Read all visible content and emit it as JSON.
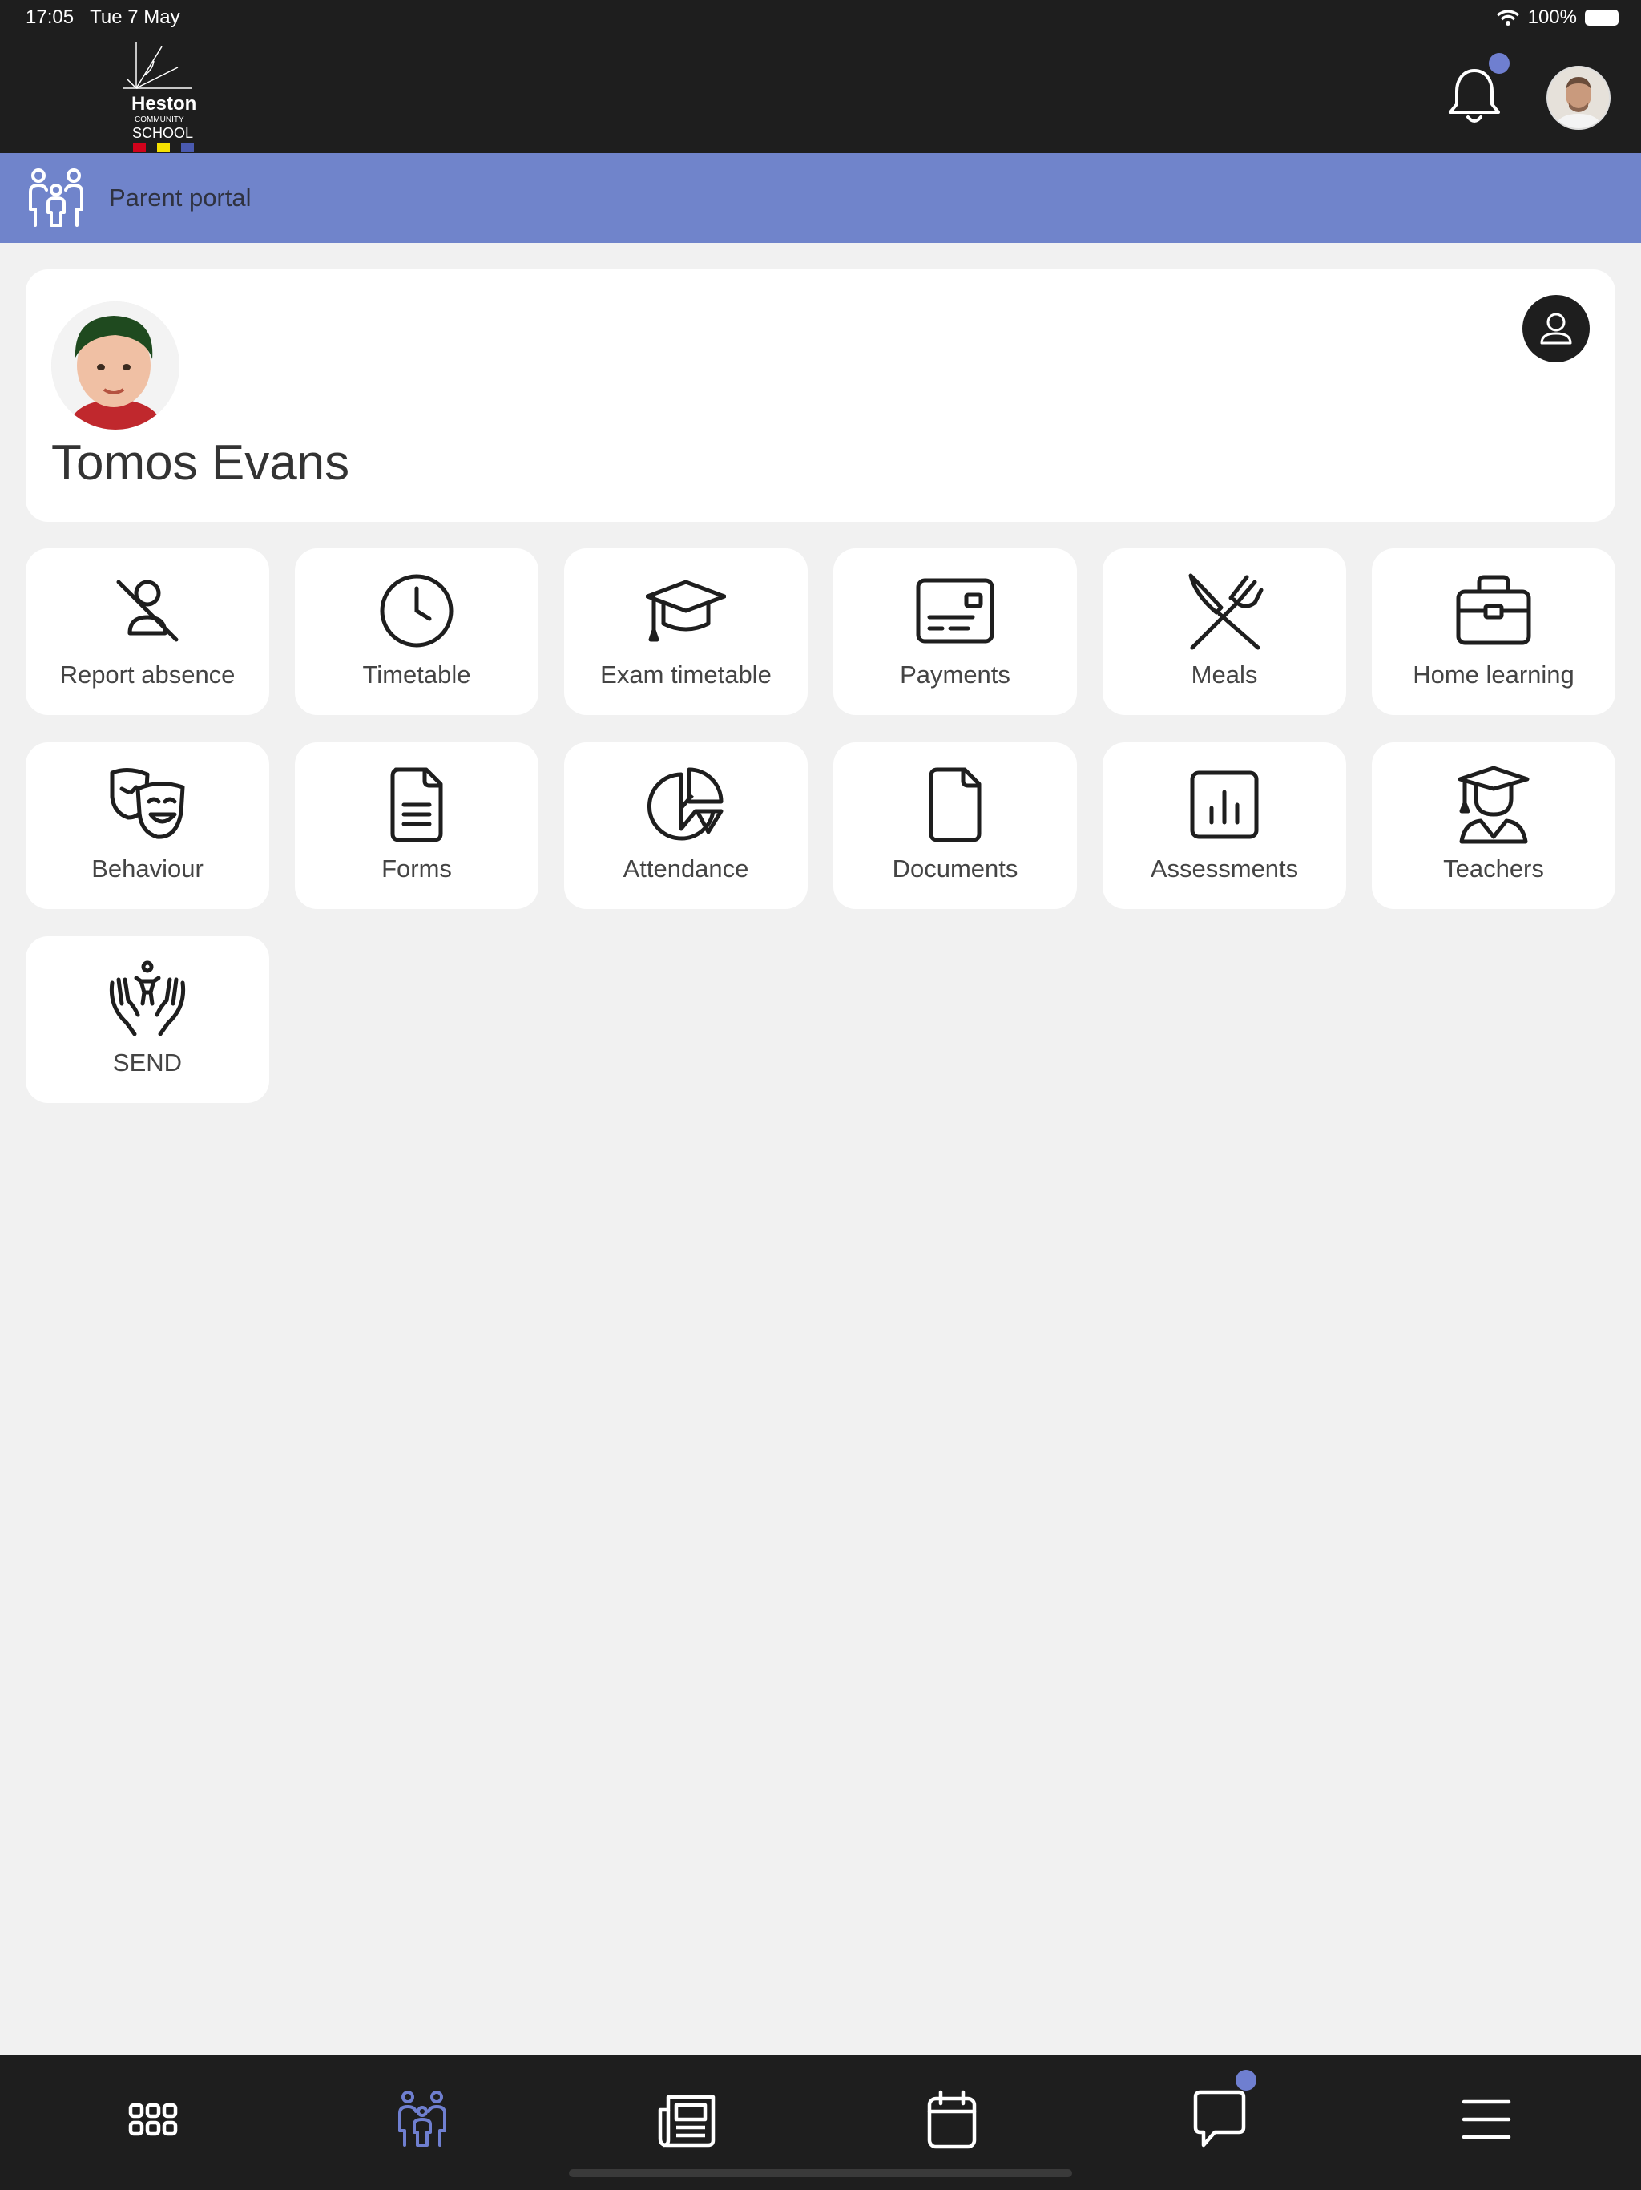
{
  "status_bar": {
    "time": "17:05",
    "date": "Tue 7 May",
    "battery": "100%"
  },
  "header": {
    "logo": {
      "name": "Heston",
      "sub1": "COMMUNITY",
      "sub2": "SCHOOL"
    },
    "notification_badge": true
  },
  "banner": {
    "label": "Parent portal",
    "icon": "family-icon"
  },
  "student": {
    "name": "Tomos Evans"
  },
  "tiles": [
    {
      "label": "Report absence",
      "icon": "person-off-icon"
    },
    {
      "label": "Timetable",
      "icon": "clock-icon"
    },
    {
      "label": "Exam timetable",
      "icon": "graduation-cap-icon"
    },
    {
      "label": "Payments",
      "icon": "card-icon"
    },
    {
      "label": "Meals",
      "icon": "cutlery-icon"
    },
    {
      "label": "Home learning",
      "icon": "briefcase-icon"
    },
    {
      "label": "Behaviour",
      "icon": "theatre-masks-icon"
    },
    {
      "label": "Forms",
      "icon": "form-document-icon"
    },
    {
      "label": "Attendance",
      "icon": "pie-chart-icon"
    },
    {
      "label": "Documents",
      "icon": "document-icon"
    },
    {
      "label": "Assessments",
      "icon": "bar-chart-icon"
    },
    {
      "label": "Teachers",
      "icon": "teacher-icon"
    },
    {
      "label": "SEND",
      "icon": "care-hands-icon"
    }
  ],
  "bottom_nav": [
    {
      "icon": "apps-grid-icon",
      "active": false
    },
    {
      "icon": "family-icon",
      "active": true
    },
    {
      "icon": "news-icon",
      "active": false
    },
    {
      "icon": "calendar-icon",
      "active": false
    },
    {
      "icon": "chat-icon",
      "active": false,
      "badge": true
    },
    {
      "icon": "menu-icon",
      "active": false
    }
  ],
  "colors": {
    "header_bg": "#1e1e1e",
    "banner_bg": "#7084cb",
    "accent": "#6f7fd0",
    "page_bg": "#f1f1f1",
    "card_bg": "#ffffff",
    "icon_dark": "#1e1e1e"
  }
}
